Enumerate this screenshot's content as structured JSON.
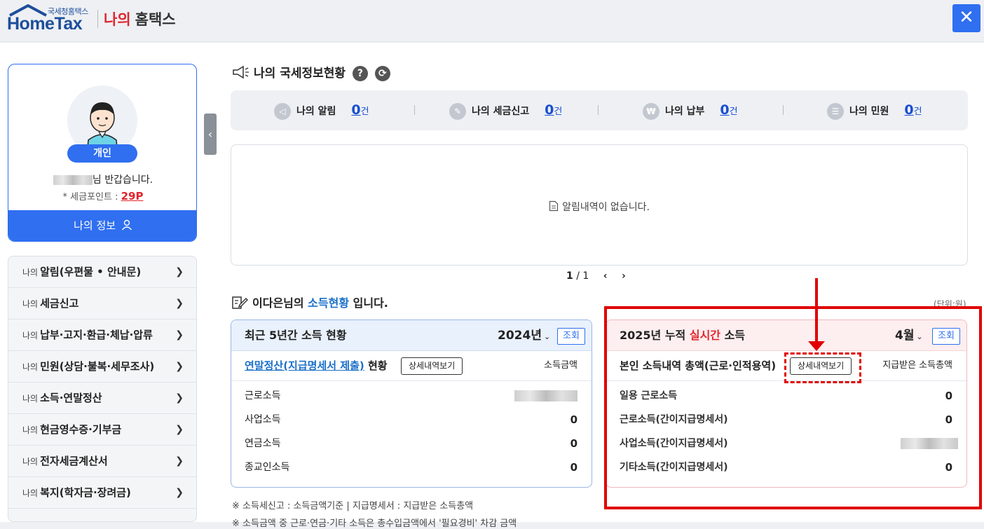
{
  "header": {
    "logo_sub": "국세청홈택스",
    "logo_main": "HomeTax",
    "my_label": "나의",
    "hometax_label": "홈택스",
    "close_icon": "close-icon"
  },
  "profile": {
    "badge": "개인",
    "greeting_suffix": "님 반갑습니다.",
    "points_label": "* 세금포인트 : ",
    "points_value": "29P",
    "myinfo_button": "나의 정보"
  },
  "menu": {
    "items": [
      {
        "prefix": "나의",
        "label": "알림(우편물 • 안내문)"
      },
      {
        "prefix": "나의",
        "label": "세금신고"
      },
      {
        "prefix": "나의",
        "label": "납부·고지·환급·체납·압류"
      },
      {
        "prefix": "나의",
        "label": "민원(상담·불복·세무조사)"
      },
      {
        "prefix": "나의",
        "label": "소득·연말정산"
      },
      {
        "prefix": "나의",
        "label": "현금영수증·기부금"
      },
      {
        "prefix": "나의",
        "label": "전자세금계산서"
      },
      {
        "prefix": "나의",
        "label": "복지(학자금·장려금)"
      }
    ]
  },
  "status": {
    "title": "나의 국세정보현황",
    "help_icon": "?",
    "items": [
      {
        "label": "나의 알림",
        "count": "0",
        "unit": "건"
      },
      {
        "label": "나의 세금신고",
        "count": "0",
        "unit": "건"
      },
      {
        "label": "나의 납부",
        "count": "0",
        "unit": "건"
      },
      {
        "label": "나의 민원",
        "count": "0",
        "unit": "건"
      }
    ]
  },
  "notice": {
    "empty_text": "알림내역이 없습니다.",
    "page_current": "1",
    "page_sep": " / ",
    "page_total": "1"
  },
  "income": {
    "title_pre": "이다은님의 ",
    "title_hl": "소득현황",
    "title_post": " 입니다.",
    "unit": "(단위:원)",
    "left": {
      "title": "최근 5년간 소득 현황",
      "year": "2024년",
      "query_btn": "조회",
      "subtitle_link": "연말정산(지급명세서 제출)",
      "subtitle_post": " 현황",
      "detail_btn": "상세내역보기",
      "col_label": "소득금액",
      "rows": [
        {
          "label": "근로소득",
          "value": ""
        },
        {
          "label": "사업소득",
          "value": "0"
        },
        {
          "label": "연금소득",
          "value": "0"
        },
        {
          "label": "종교인소득",
          "value": "0"
        }
      ]
    },
    "right": {
      "title_pre": "2025년 누적 ",
      "title_red": "실시간",
      "title_post": " 소득",
      "month": "4월",
      "query_btn": "조회",
      "subtitle": "본인 소득내역 총액(근로·인적용역)",
      "detail_btn": "상세내역보기",
      "col_label": "지급받은 소득총액",
      "rows": [
        {
          "label": "일용 근로소득",
          "value": "0"
        },
        {
          "label": "근로소득(간이지급명세서)",
          "value": "0"
        },
        {
          "label": "사업소득(간이지급명세서)",
          "value": ""
        },
        {
          "label": "기타소득(간이지급명세서)",
          "value": "0"
        }
      ]
    }
  },
  "footnotes": {
    "line1": "※ 소득세신고 : 소득금액기준  |  지급명세서 : 지급받은 소득총액",
    "line2": "※ 소득금액 중 근로·연금·기타 소득은 총수입금액에서 '필요경비' 차감 금액"
  },
  "colors": {
    "accent": "#2f6ff0",
    "red": "#e0262e",
    "annotation": "#e00000"
  }
}
